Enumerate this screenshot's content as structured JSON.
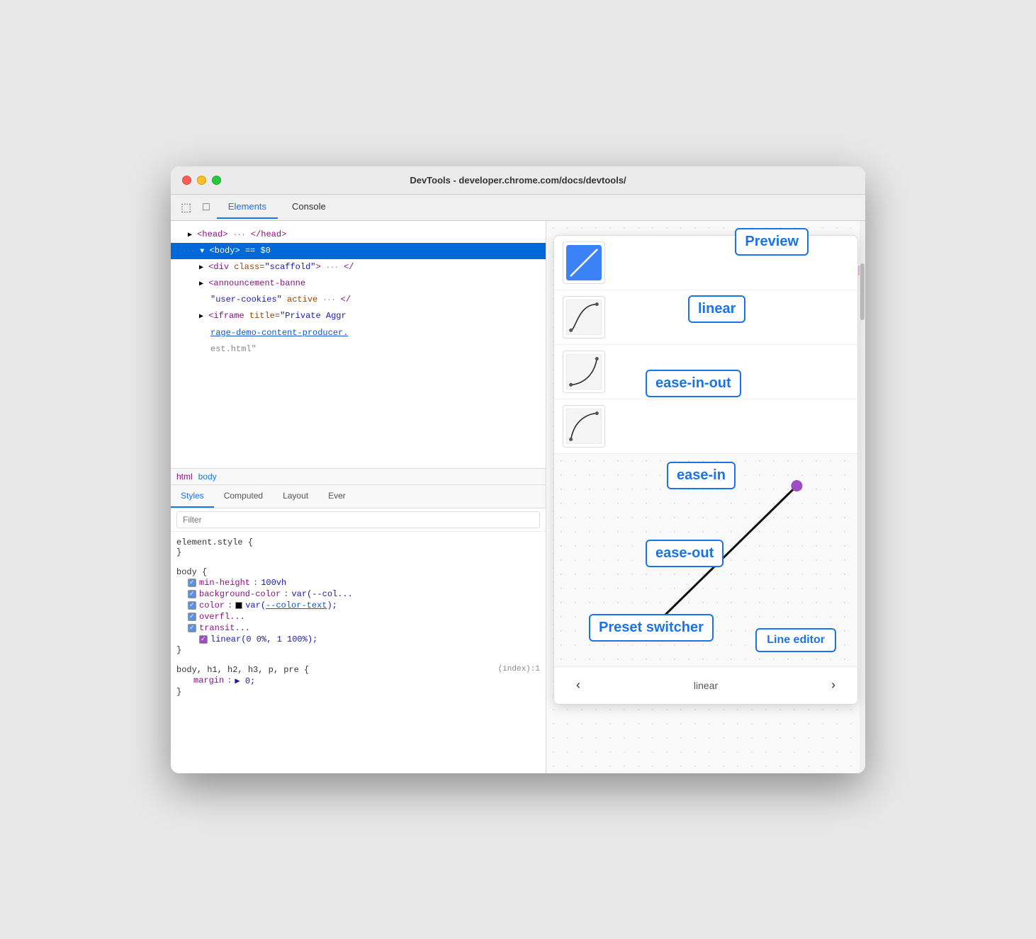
{
  "window": {
    "title": "DevTools - developer.chrome.com/docs/devtools/"
  },
  "devtools_tabs": {
    "tab1": "Elements",
    "tab2": "Console"
  },
  "dom_tree": {
    "lines": [
      {
        "indent": 1,
        "content": "▶ <head> ··· </head>",
        "type": "normal"
      },
      {
        "indent": 0,
        "content": "··· ▼ <body> == $0",
        "type": "selected"
      },
      {
        "indent": 2,
        "content": "▶ <div class=\"scaffold\"> ··· </",
        "type": "normal"
      },
      {
        "indent": 2,
        "content": "▶ <announcement-banne",
        "type": "normal"
      },
      {
        "indent": 3,
        "content": "\"user-cookies\" active ··· </",
        "type": "normal"
      },
      {
        "indent": 2,
        "content": "▶ <iframe title=\"Private Aggr",
        "type": "normal"
      },
      {
        "indent": 3,
        "content": "rage-demo-content-producer.",
        "type": "link"
      },
      {
        "indent": 3,
        "content": "est.html\"",
        "type": "normal"
      }
    ]
  },
  "breadcrumb": {
    "items": [
      "html",
      "body"
    ]
  },
  "styles_tabs": {
    "tabs": [
      "Styles",
      "Computed",
      "Layout",
      "Ever"
    ]
  },
  "filter": {
    "placeholder": "Filter"
  },
  "css_rules": [
    {
      "selector": "element.style {",
      "closing": "}",
      "properties": []
    },
    {
      "selector": "body {",
      "closing": "}",
      "properties": [
        {
          "name": "min-height",
          "value": "100vh"
        },
        {
          "name": "background-color",
          "value": "var(--col..."
        },
        {
          "name": "color",
          "value": "var(--color-text);",
          "swatch": true
        },
        {
          "name": "overfl...",
          "value": ""
        },
        {
          "name": "transit...",
          "value": ""
        },
        {
          "name": "",
          "value": "linear(0 0%, 1 100%);",
          "indent": true
        }
      ]
    },
    {
      "selector": "body, h1, h2, h3, p, pre {",
      "closing": "}",
      "properties": [
        {
          "name": "margin",
          "value": "▶ 0;"
        }
      ]
    }
  ],
  "easing_popup": {
    "presets": [
      {
        "name": "linear",
        "type": "linear"
      },
      {
        "name": "ease-in-out",
        "type": "ease-in-out"
      },
      {
        "name": "ease-in",
        "type": "ease-in"
      },
      {
        "name": "ease-out",
        "type": "ease-out"
      }
    ],
    "current": "linear",
    "nav_prev": "‹",
    "nav_next": "›"
  },
  "labels": {
    "preview": "Preview",
    "linear": "linear",
    "ease_in_out": "ease-in-out",
    "ease_in": "ease-in",
    "ease_out": "ease-out",
    "preset_switcher": "Preset switcher",
    "line_editor": "Line editor"
  },
  "source_ref": "(index):1"
}
